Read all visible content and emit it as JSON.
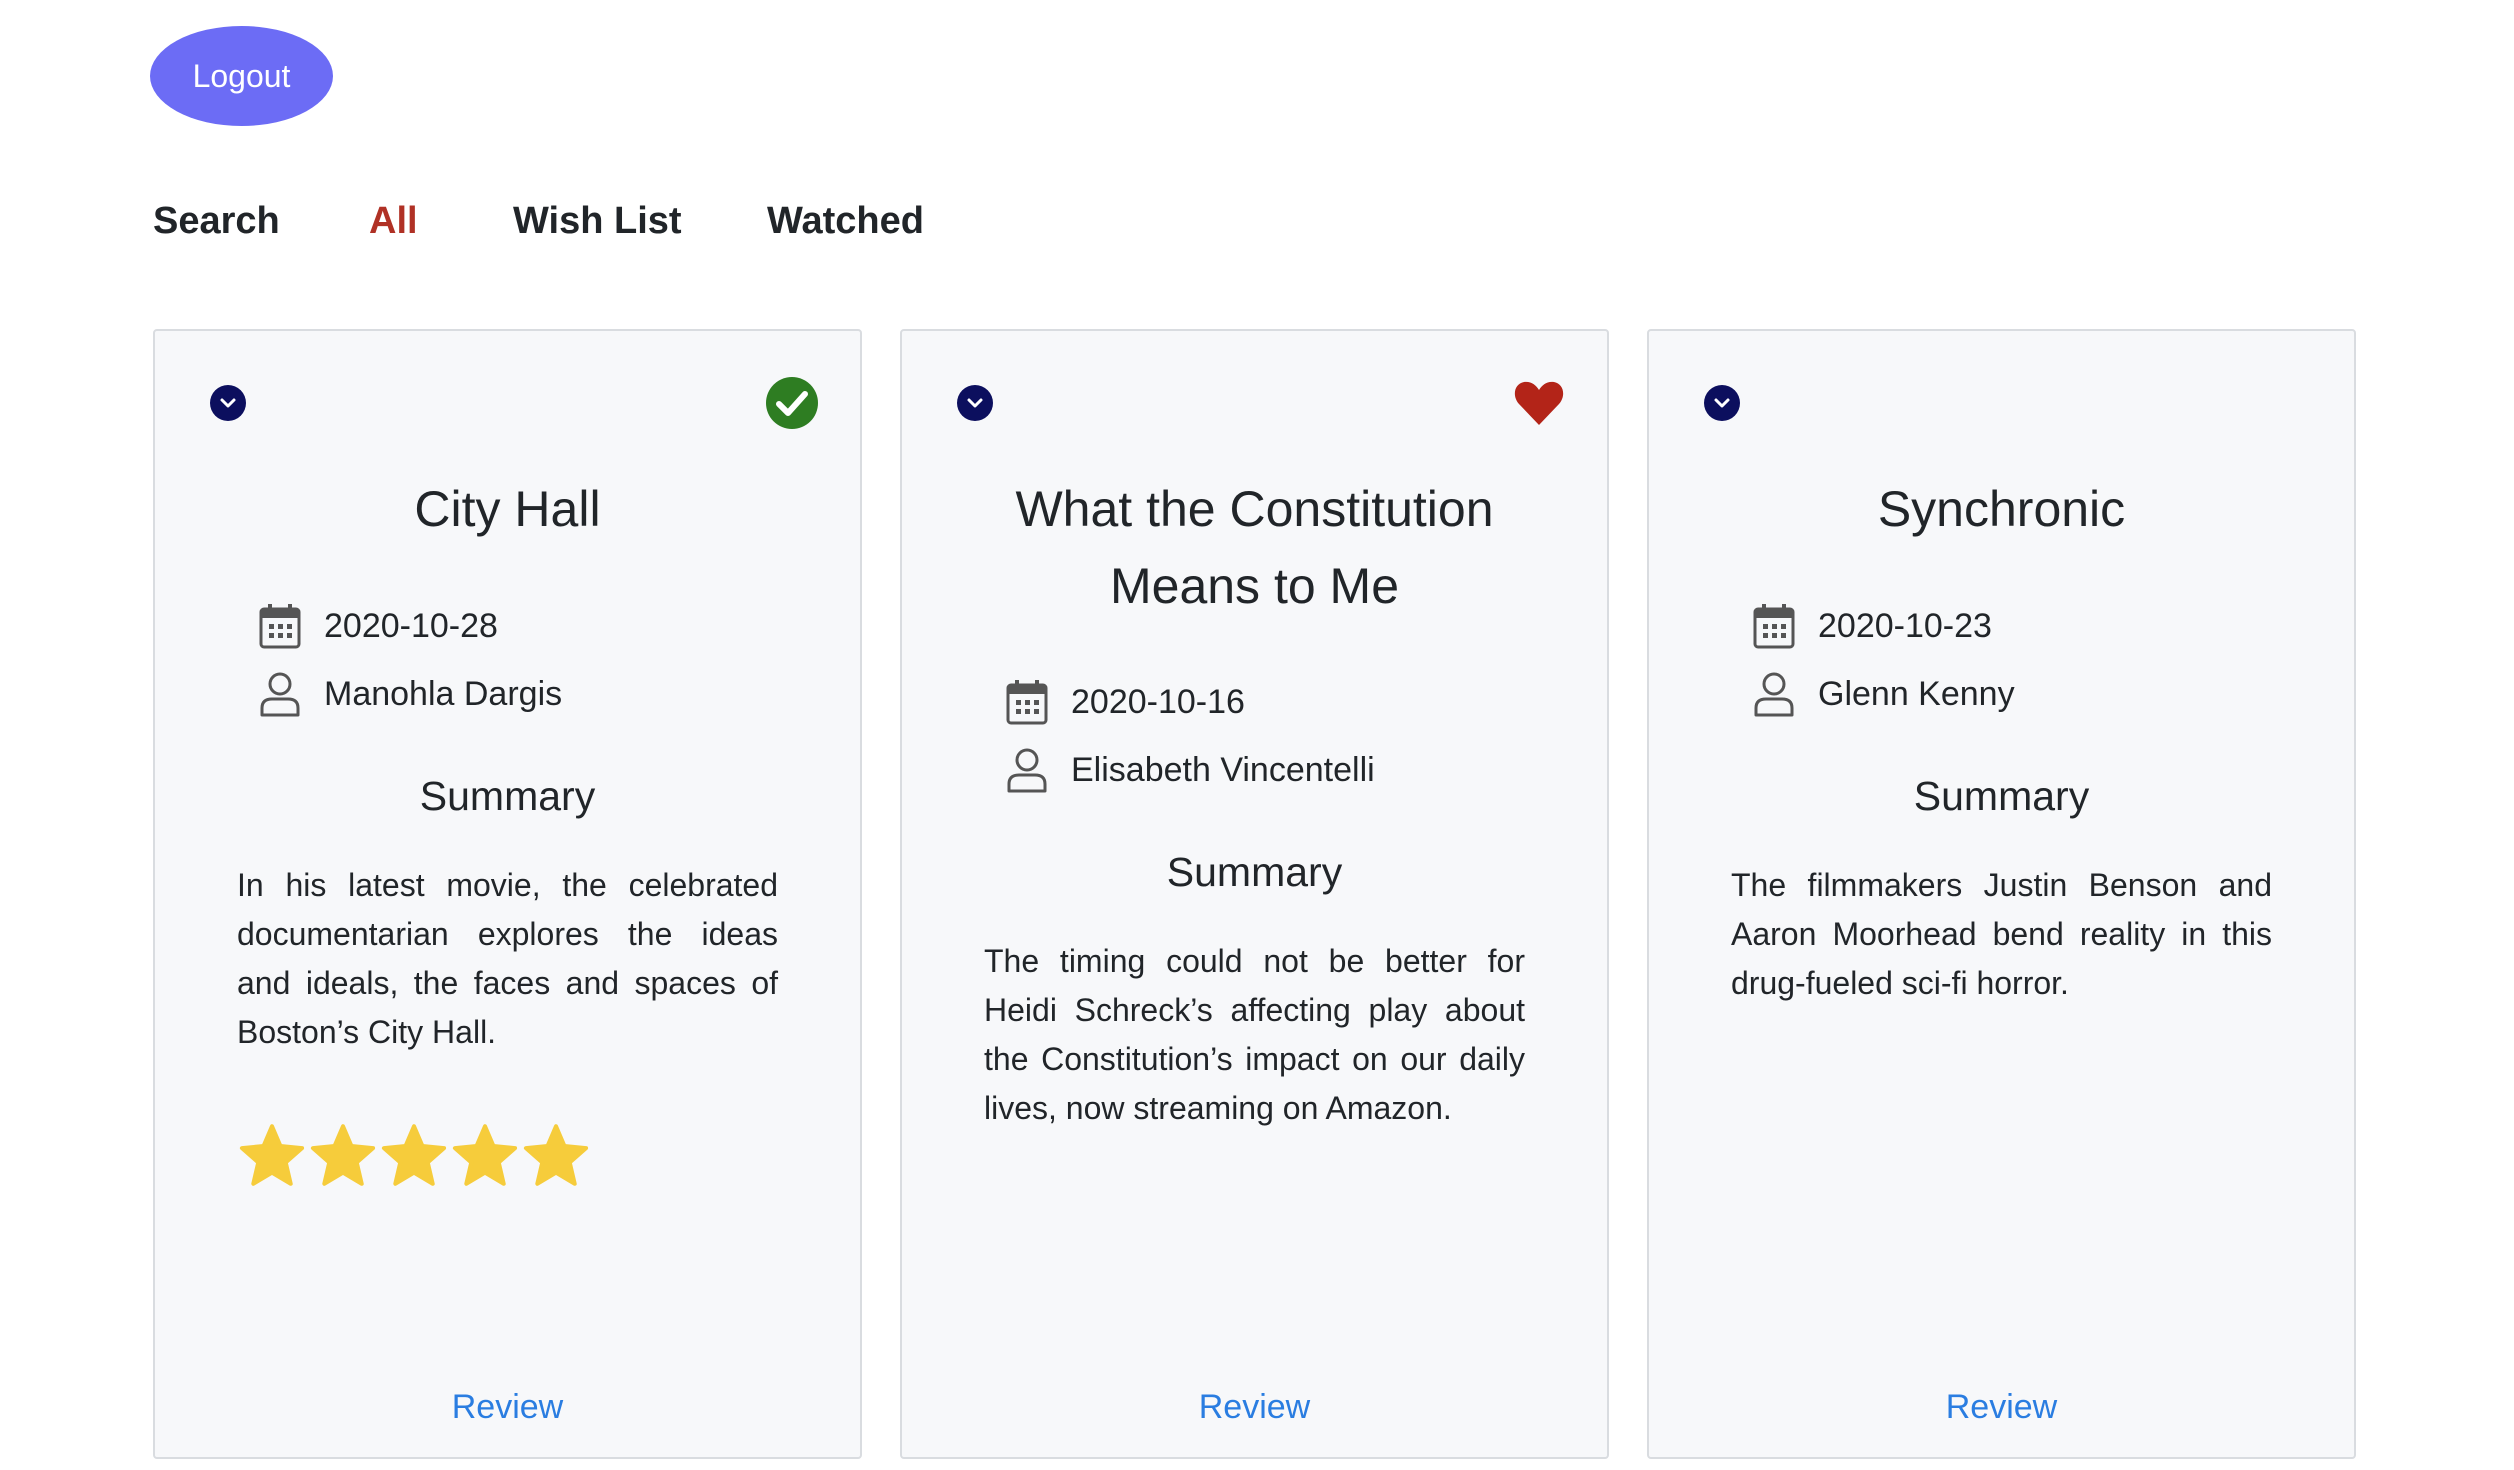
{
  "header": {
    "logout_label": "Logout"
  },
  "nav": {
    "tabs": [
      {
        "label": "Search",
        "active": false
      },
      {
        "label": "All",
        "active": true
      },
      {
        "label": "Wish List",
        "active": false
      },
      {
        "label": "Watched",
        "active": false
      }
    ]
  },
  "colors": {
    "accent": "#6c6cf5",
    "active_tab": "#b03125",
    "link": "#2a7de1",
    "watched_check": "#2e7d22",
    "wishlist_heart": "#b32418",
    "star": "#f6cc3b",
    "expand_button": "#0c0f5e"
  },
  "cards": [
    {
      "title_lines": [
        "City Hall",
        ""
      ],
      "status_icon": "check-circle-icon",
      "date": "2020-10-28",
      "critic": "Manohla Dargis",
      "summary_heading": "Summary",
      "summary": "In his latest movie, the celebrated documentarian explores the ideas and ideals, the faces and spaces of Boston’s City Hall.",
      "rating": 5,
      "review_label": "Review"
    },
    {
      "title_lines": [
        "What the Constitution",
        "Means to Me"
      ],
      "status_icon": "heart-icon",
      "date": "2020-10-16",
      "critic": "Elisabeth Vincentelli",
      "summary_heading": "Summary",
      "summary": "The timing could not be better for Heidi Schreck’s affecting play about the Constitution’s impact on our daily lives, now streaming on Amazon.",
      "rating": 0,
      "review_label": "Review"
    },
    {
      "title_lines": [
        "Synchronic",
        ""
      ],
      "status_icon": "none",
      "date": "2020-10-23",
      "critic": "Glenn Kenny",
      "summary_heading": "Summary",
      "summary": "The filmmakers Justin Benson and Aaron Moorhead bend reality in this drug-fueled sci-fi horror.",
      "rating": 0,
      "review_label": "Review"
    }
  ]
}
